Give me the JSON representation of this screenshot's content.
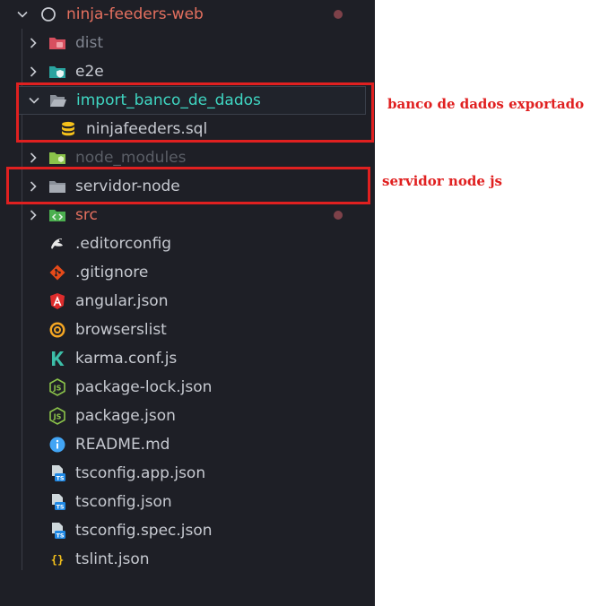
{
  "explorer": {
    "root": {
      "label": "ninja-feeders-web",
      "icon": "circle-outline-icon"
    },
    "items": [
      {
        "label": "dist",
        "type": "folder",
        "icon": "folder-dist-icon",
        "color": "#808590"
      },
      {
        "label": "e2e",
        "type": "folder",
        "icon": "folder-e2e-icon",
        "color": "#c7cad1"
      },
      {
        "label": "import_banco_de_dados",
        "type": "folder-open",
        "icon": "folder-open-icon",
        "color": "#3fd6c2"
      },
      {
        "label": "ninjafeeders.sql",
        "type": "file",
        "icon": "database-icon",
        "color": "#c7cad1"
      },
      {
        "label": "node_modules",
        "type": "folder",
        "icon": "folder-node-icon",
        "color": "#5a5e66"
      },
      {
        "label": "servidor-node",
        "type": "folder",
        "icon": "folder-icon",
        "color": "#c7cad1"
      },
      {
        "label": "src",
        "type": "folder",
        "icon": "folder-src-icon",
        "color": "#e5705f"
      },
      {
        "label": ".editorconfig",
        "type": "file",
        "icon": "editorconfig-icon",
        "color": "#c7cad1"
      },
      {
        "label": ".gitignore",
        "type": "file",
        "icon": "git-icon",
        "color": "#c7cad1"
      },
      {
        "label": "angular.json",
        "type": "file",
        "icon": "angular-icon",
        "color": "#c7cad1"
      },
      {
        "label": "browserslist",
        "type": "file",
        "icon": "browserslist-icon",
        "color": "#c7cad1"
      },
      {
        "label": "karma.conf.js",
        "type": "file",
        "icon": "karma-icon",
        "color": "#c7cad1"
      },
      {
        "label": "package-lock.json",
        "type": "file",
        "icon": "nodejs-icon",
        "color": "#c7cad1"
      },
      {
        "label": "package.json",
        "type": "file",
        "icon": "nodejs-icon",
        "color": "#c7cad1"
      },
      {
        "label": "README.md",
        "type": "file",
        "icon": "info-icon",
        "color": "#c7cad1"
      },
      {
        "label": "tsconfig.app.json",
        "type": "file",
        "icon": "tsconfig-icon",
        "color": "#c7cad1"
      },
      {
        "label": "tsconfig.json",
        "type": "file",
        "icon": "tsconfig-icon",
        "color": "#c7cad1"
      },
      {
        "label": "tsconfig.spec.json",
        "type": "file",
        "icon": "tsconfig-icon",
        "color": "#c7cad1"
      },
      {
        "label": "tslint.json",
        "type": "file",
        "icon": "json-braces-icon",
        "color": "#c7cad1"
      }
    ]
  },
  "annotations": {
    "banco": "banco de dados exportado",
    "servidor": "servidor node js"
  },
  "colors": {
    "background": "#1e1f26",
    "annotation": "#e02020",
    "root_label": "#e5705f",
    "modified_dot": "#7d4149"
  }
}
